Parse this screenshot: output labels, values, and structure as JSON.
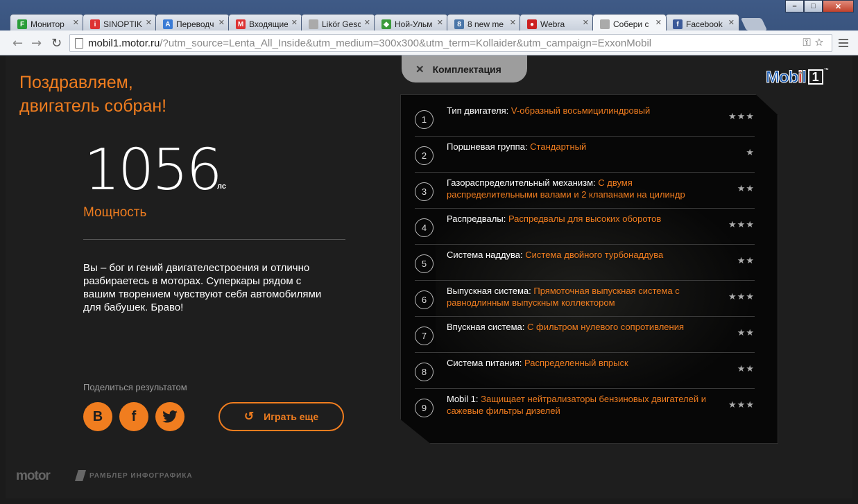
{
  "browser": {
    "tabs": [
      {
        "label": "Монитор",
        "fav": "F",
        "color": "#2a9d3a"
      },
      {
        "label": "SINOPTIK",
        "fav": "i",
        "color": "#d33"
      },
      {
        "label": "Переводч",
        "fav": "A",
        "color": "#3a7bd5"
      },
      {
        "label": "Входящие",
        "fav": "M",
        "color": "#d33"
      },
      {
        "label": "Likör Gesc",
        "fav": "",
        "color": "#aaa"
      },
      {
        "label": "Ной-Ульм",
        "fav": "◆",
        "color": "#3b9a3b"
      },
      {
        "label": "8 new me",
        "fav": "8",
        "color": "#4a76a8"
      },
      {
        "label": "Webra",
        "fav": "●",
        "color": "#c22"
      },
      {
        "label": "Собери с",
        "fav": "",
        "color": "#aaa"
      },
      {
        "label": "Facebook",
        "fav": "f",
        "color": "#3b5998"
      }
    ],
    "url_host": "mobil1.motor.ru",
    "url_path": "/?utm_source=Lenta_All_Inside&utm_medium=300x300&utm_term=Kollaider&utm_campaign=ExxonMobil"
  },
  "result": {
    "heading_line1": "Поздравляем,",
    "heading_line2": "двигатель собран!",
    "power_value": "1056",
    "power_unit": "лс",
    "power_label": "Мощность",
    "description": "Вы – бог и гений двигателестроения и отлично разбираетесь в моторах. Суперкары рядом с вашим творением чувствуют себя автомобилями для бабушек. Браво!",
    "share_label": "Поделиться результатом",
    "social": [
      {
        "name": "vkontakte",
        "glyph": "В"
      },
      {
        "name": "facebook",
        "glyph": "f"
      },
      {
        "name": "twitter",
        "glyph": "t"
      }
    ],
    "replay_label": "Играть еще"
  },
  "footer": {
    "motor_logo": "motor",
    "rambler_logo": "РАМБЛЕР ИНФОГРАФИКА"
  },
  "panel": {
    "toggle_label": "Комплектация",
    "brand": {
      "name": "Mobil",
      "mark": "1",
      "tm": "™"
    },
    "rows": [
      {
        "num": "1",
        "label": "Тип двигателя:",
        "value": "V-образный восьмицилиндровый",
        "stars": "★★★"
      },
      {
        "num": "2",
        "label": "Поршневая группа:",
        "value": "Стандартный",
        "stars": "★"
      },
      {
        "num": "3",
        "label": "Газораспределительный механизм:",
        "value": "С двумя распределительными валами и 2 клапанами на цилиндр",
        "stars": "★★"
      },
      {
        "num": "4",
        "label": "Распредвалы:",
        "value": "Распредвалы для высоких оборотов",
        "stars": "★★★"
      },
      {
        "num": "5",
        "label": "Система наддува:",
        "value": "Система двойного турбонаддува",
        "stars": "★★"
      },
      {
        "num": "6",
        "label": "Выпускная система:",
        "value": "Прямоточная выпускная система с равнодлинным выпускным коллектором",
        "stars": "★★★"
      },
      {
        "num": "7",
        "label": "Впускная система:",
        "value": "С фильтром нулевого сопротивления",
        "stars": "★★"
      },
      {
        "num": "8",
        "label": "Система питания:",
        "value": "Распределенный впрыск",
        "stars": "★★"
      },
      {
        "num": "9",
        "label": "Mobil 1:",
        "value": "Защищает нейтрализаторы бензиновых двигателей и сажевые фильтры дизелей",
        "stars": "★★★"
      }
    ]
  },
  "colors": {
    "accent": "#f07d1f",
    "background": "#1e1e1e",
    "panel": "#070707"
  }
}
